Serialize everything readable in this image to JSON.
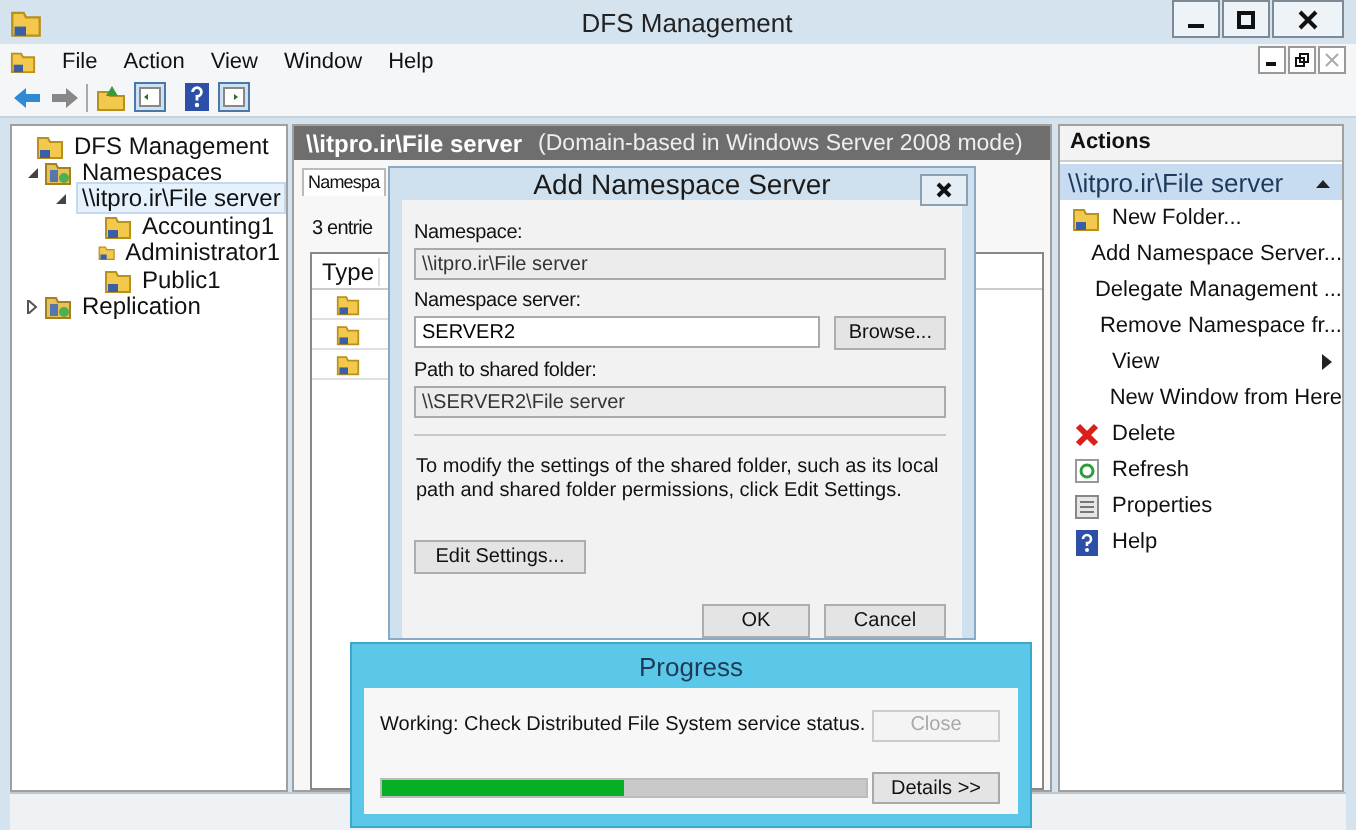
{
  "window": {
    "title": "DFS Management"
  },
  "menu": [
    "File",
    "Action",
    "View",
    "Window",
    "Help"
  ],
  "tree": [
    {
      "label": "DFS Management",
      "selected": false,
      "children": [
        {
          "label": "Namespaces",
          "selected": false,
          "expanded": true,
          "children": [
            {
              "label": "\\\\itpro.ir\\File server",
              "selected": true,
              "expanded": true,
              "children": [
                {
                  "label": "Accounting1",
                  "selected": false
                },
                {
                  "label": "Administrator1",
                  "selected": false
                },
                {
                  "label": "Public1",
                  "selected": false
                }
              ]
            }
          ]
        },
        {
          "label": "Replication",
          "selected": false,
          "expanded": false
        }
      ]
    }
  ],
  "center": {
    "title": "\\\\itpro.ir\\File server",
    "subtitle": "(Domain-based in Windows Server 2008 mode)",
    "tabs": [
      {
        "label": "Namespa",
        "selected": true
      }
    ],
    "entries": "3 entrie",
    "table": {
      "columns": [
        "Type"
      ],
      "rows": [
        {
          "kind": "folder"
        },
        {
          "kind": "folder"
        },
        {
          "kind": "folder"
        }
      ]
    }
  },
  "actions": {
    "title": "Actions",
    "section": {
      "label": "\\\\itpro.ir\\File server",
      "expanded": true
    },
    "items": [
      {
        "label": "New Folder...",
        "kind": "folder"
      },
      {
        "label": "Add Namespace Server...",
        "kind": "plain"
      },
      {
        "label": "Delegate Management ...",
        "kind": "plain"
      },
      {
        "label": "Remove Namespace fr...",
        "kind": "plain"
      },
      {
        "label": "View",
        "kind": "submenu"
      },
      {
        "label": "New Window from Here",
        "kind": "plain"
      },
      {
        "label": "Delete",
        "kind": "delete"
      },
      {
        "label": "Refresh",
        "kind": "refresh"
      },
      {
        "label": "Properties",
        "kind": "properties"
      },
      {
        "label": "Help",
        "kind": "help"
      }
    ]
  },
  "dialog": {
    "title": "Add Namespace Server",
    "fields": [
      {
        "label": "Namespace:",
        "value": "\\\\itpro.ir\\File server",
        "readonly": true
      },
      {
        "label": "Namespace server:",
        "value": "SERVER2",
        "readonly": false,
        "button": "Browse..."
      },
      {
        "label": "Path to shared folder:",
        "value": "\\\\SERVER2\\File server",
        "readonly": true
      }
    ],
    "note": "To modify the settings of the shared folder, such as its local path and shared folder permissions, click Edit Settings.",
    "edit_button": "Edit Settings...",
    "buttons": [
      "OK",
      "Cancel"
    ]
  },
  "progress": {
    "title": "Progress",
    "status": "Working: Check Distributed File System service status.",
    "level": 0.5,
    "buttons": [
      {
        "label": "Close",
        "disabled": true
      },
      {
        "label": "Details >>",
        "disabled": false
      }
    ]
  }
}
